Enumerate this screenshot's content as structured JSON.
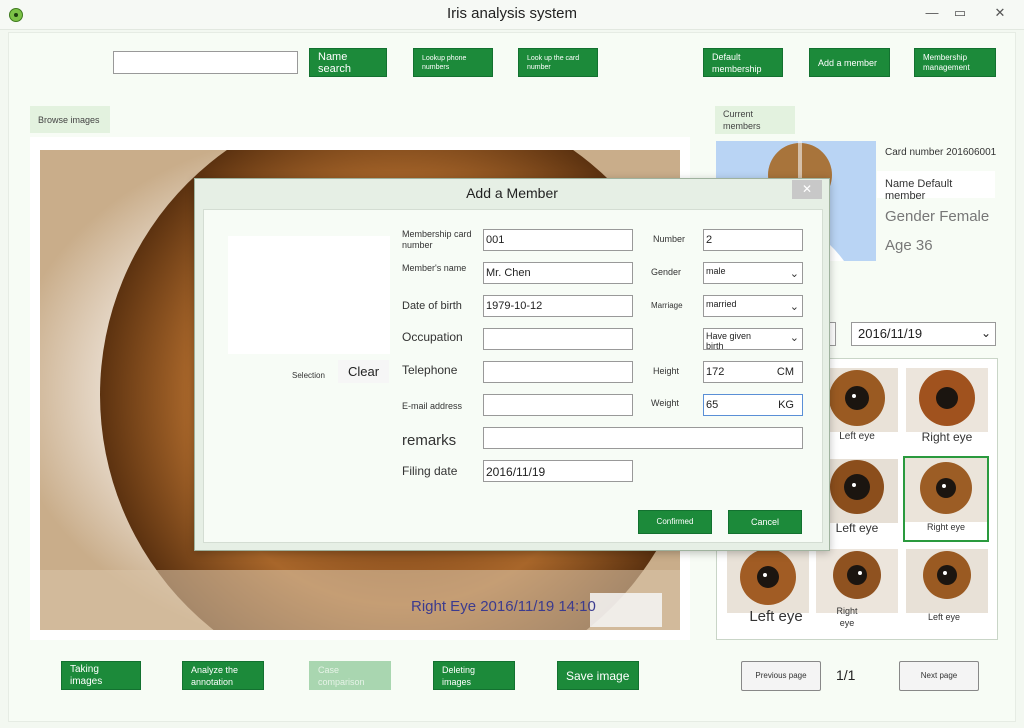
{
  "window": {
    "title": "Iris analysis system"
  },
  "toolbar": {
    "search_value": "",
    "name_search": "Name search",
    "lookup_phone": "Lookup phone numbers",
    "lookup_card": "Look up the card number",
    "default_membership": "Default membership",
    "add_member": "Add a member",
    "membership_management": "Membership management"
  },
  "browse_images": "Browse images",
  "current_members": "Current members",
  "image_caption": "Right Eye 2016/11/19 14:10",
  "member_info": {
    "card_number": "Card number 201606001",
    "name": "Name Default member",
    "gender": "Gender Female",
    "age": "Age 36"
  },
  "date_filter": {
    "value": "2016/11/19"
  },
  "thumbnails": [
    {
      "label": "Left eye"
    },
    {
      "label": "Right eye"
    },
    {
      "label": "Left eye"
    },
    {
      "label": "Right eye"
    },
    {
      "label": "Left eye"
    },
    {
      "label": "Right eye"
    },
    {
      "label": "Left eye"
    }
  ],
  "pager": {
    "prev": "Previous page",
    "page": "1/1",
    "next": "Next page"
  },
  "bottom_buttons": {
    "taking_images": "Taking images",
    "analyze": "Analyze the annotation",
    "case_comparison": "Case comparison",
    "deleting_images": "Deleting images",
    "save_image": "Save image"
  },
  "dialog": {
    "title": "Add a Member",
    "close": "✕",
    "selection": "Selection",
    "clear": "Clear",
    "labels": {
      "card_number": "Membership card number",
      "member_name": "Member's name",
      "dob": "Date of birth",
      "occupation": "Occupation",
      "telephone": "Telephone",
      "email": "E-mail address",
      "remarks": "remarks",
      "filing_date": "Filing date",
      "number": "Number",
      "gender": "Gender",
      "marriage": "Marriage",
      "height": "Height",
      "weight": "Weight"
    },
    "values": {
      "card_number": "001",
      "member_name": "Mr. Chen",
      "dob": "1979-10-12",
      "occupation": "",
      "telephone": "",
      "email": "",
      "remarks": "",
      "filing_date": "2016/11/19",
      "number": "2",
      "gender": "male",
      "marriage": "married",
      "birth": "Have given birth",
      "height": "172",
      "height_unit": "CM",
      "weight": "65",
      "weight_unit": "KG"
    },
    "confirm": "Confirmed",
    "cancel": "Cancel"
  }
}
